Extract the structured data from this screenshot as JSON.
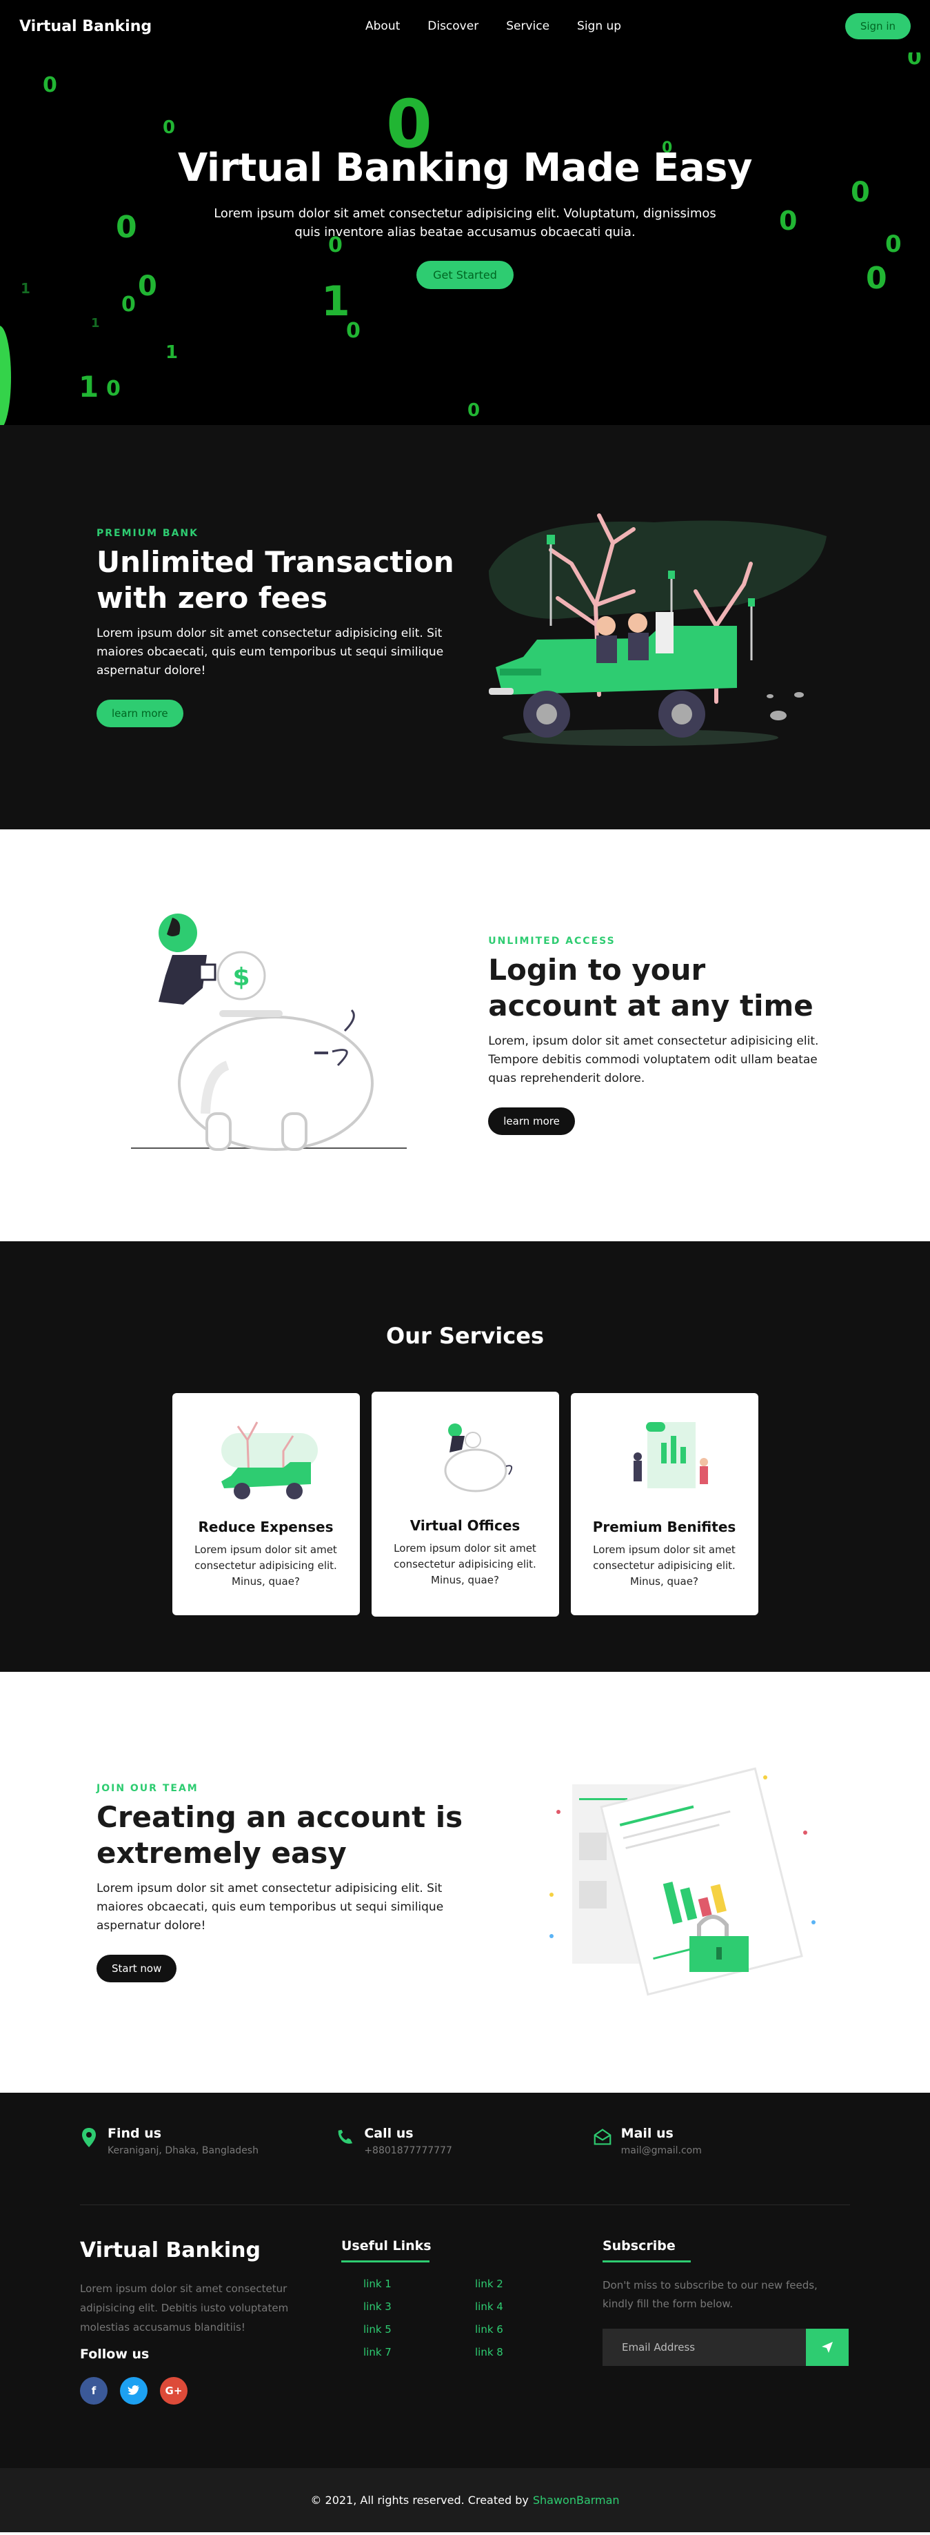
{
  "nav": {
    "brand": "Virtual Banking",
    "links": [
      "About",
      "Discover",
      "Service",
      "Sign up"
    ],
    "signin": "Sign in"
  },
  "hero": {
    "title": "Virtual Banking Made Easy",
    "text": "Lorem ipsum dolor sit amet consectetur adipisicing elit. Voluptatum, dignissimos quis inventore alias beatae accusamus obcaecati quia.",
    "cta": "Get Started"
  },
  "section1": {
    "eyebrow": "PREMIUM BANK",
    "title": "Unlimited Transaction with zero fees",
    "text": "Lorem ipsum dolor sit amet consectetur adipisicing elit. Sit maiores obcaecati, quis eum temporibus ut sequi similique aspernatur dolore!",
    "cta": "learn more"
  },
  "section2": {
    "eyebrow": "UNLIMITED ACCESS",
    "title": "Login to your account at any time",
    "text": "Lorem, ipsum dolor sit amet consectetur adipisicing elit. Tempore debitis commodi voluptatem odit ullam beatae quas reprehenderit dolore.",
    "cta": "learn more"
  },
  "services": {
    "title": "Our Services",
    "cards": [
      {
        "title": "Reduce Expenses",
        "text": "Lorem ipsum dolor sit amet consectetur adipisicing elit. Minus, quae?"
      },
      {
        "title": "Virtual Offices",
        "text": "Lorem ipsum dolor sit amet consectetur adipisicing elit. Minus, quae?"
      },
      {
        "title": "Premium Benifites",
        "text": "Lorem ipsum dolor sit amet consectetur adipisicing elit. Minus, quae?"
      }
    ]
  },
  "section3": {
    "eyebrow": "JOIN OUR TEAM",
    "title": "Creating an account is extremely easy",
    "text": "Lorem ipsum dolor sit amet consectetur adipisicing elit. Sit maiores obcaecati, quis eum temporibus ut sequi similique aspernatur dolore!",
    "cta": "Start now"
  },
  "footer": {
    "contacts": [
      {
        "title": "Find us",
        "sub": "Keraniganj, Dhaka, Bangladesh",
        "icon": "map-pin-icon"
      },
      {
        "title": "Call us",
        "sub": "+8801877777777",
        "icon": "phone-icon"
      },
      {
        "title": "Mail us",
        "sub": "mail@gmail.com",
        "icon": "mail-icon"
      }
    ],
    "brand": "Virtual Banking",
    "description": "Lorem ipsum dolor sit amet consectetur adipisicing elit. Debitis iusto voluptatem molestias accusamus blanditiis!",
    "follow": "Follow us",
    "socials": [
      {
        "name": "facebook-icon",
        "glyph": "f",
        "color": "#3b5998"
      },
      {
        "name": "twitter-icon",
        "glyph": "t",
        "color": "#1da1f2"
      },
      {
        "name": "google-plus-icon",
        "glyph": "G+",
        "color": "#dd4b39"
      }
    ],
    "useful_links_title": "Useful Links",
    "links": [
      "link 1",
      "link 2",
      "link 3",
      "link 4",
      "link 5",
      "link 6",
      "link 7",
      "link 8"
    ],
    "subscribe_title": "Subscribe",
    "subscribe_text": "Don't miss to subscribe to our new feeds, kindly fill the form below.",
    "email_placeholder": "Email Address",
    "copyright": "© 2021, All rights reserved. Created by",
    "author": "ShawonBarman"
  },
  "colors": {
    "accent": "#2ecc71",
    "dark": "#111111",
    "matrix": "#21b533"
  }
}
